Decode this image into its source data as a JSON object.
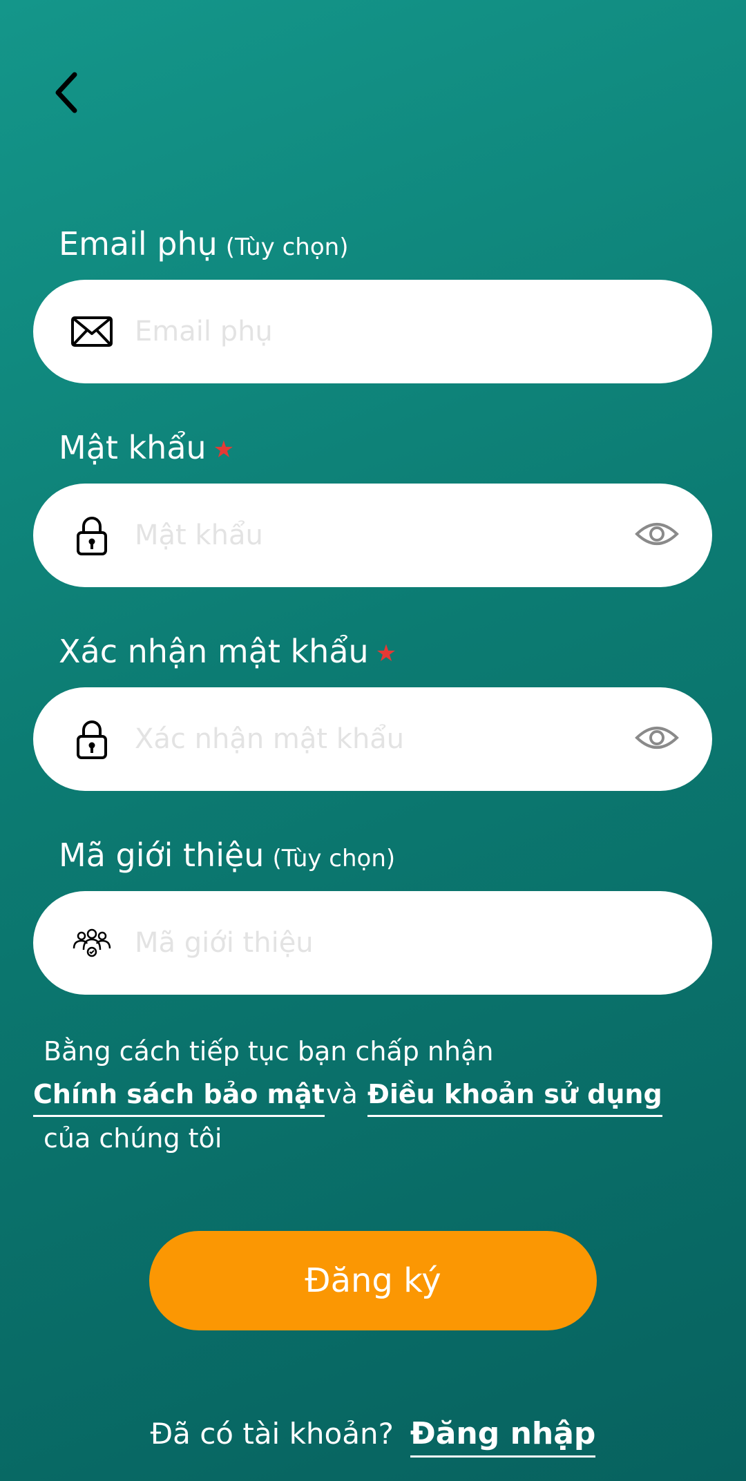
{
  "nav": {
    "back_icon": "chevron-left-icon"
  },
  "fields": {
    "secondary_email": {
      "label": "Email phụ",
      "optional": "(Tùy chọn)",
      "placeholder": "Email phụ",
      "icon": "envelope-icon"
    },
    "password": {
      "label": "Mật khẩu",
      "required_mark": "★",
      "placeholder": "Mật khẩu",
      "icon": "lock-icon",
      "toggle_icon": "eye-icon"
    },
    "confirm_password": {
      "label": "Xác nhận mật khẩu",
      "required_mark": "★",
      "placeholder": "Xác nhận mật khẩu",
      "icon": "lock-icon",
      "toggle_icon": "eye-icon"
    },
    "referral_code": {
      "label": "Mã giới thiệu",
      "optional": "(Tùy chọn)",
      "placeholder": "Mã giới thiệu",
      "icon": "people-group-icon"
    }
  },
  "consent": {
    "intro": "Bằng cách tiếp tục bạn chấp nhận",
    "privacy_link": "Chính sách bảo mật",
    "conjunction": "và",
    "terms_link": "Điều khoản sử dụng",
    "outro": "của chúng tôi"
  },
  "actions": {
    "register_label": "Đăng ký"
  },
  "footer": {
    "prompt": "Đã có tài khoản?",
    "login_link": "Đăng nhập"
  },
  "colors": {
    "background_top": "#14968a",
    "background_bottom": "#07625f",
    "primary_button": "#fb9703",
    "required_star": "#e53935",
    "placeholder": "#e3e3e3"
  }
}
